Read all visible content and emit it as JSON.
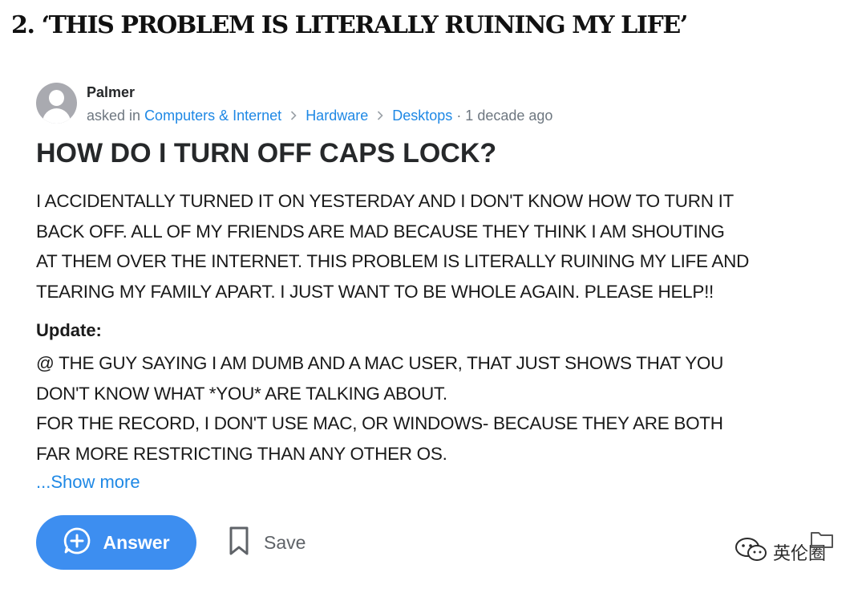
{
  "article": {
    "heading": "2. ‘THIS PROBLEM IS LITERALLY RUINING MY LIFE’"
  },
  "question": {
    "author": "Palmer",
    "asked_in_prefix": "asked in",
    "breadcrumb": [
      "Computers & Internet",
      "Hardware",
      "Desktops"
    ],
    "time_ago": "· 1 decade ago",
    "title": "HOW DO I TURN OFF CAPS LOCK?",
    "body_lines": [
      "I ACCIDENTALLY TURNED IT ON YESTERDAY AND I DON'T KNOW HOW TO TURN IT",
      "BACK OFF. ALL OF MY FRIENDS ARE MAD BECAUSE THEY THINK I AM SHOUTING",
      "AT THEM OVER THE INTERNET. THIS PROBLEM IS LITERALLY RUINING MY LIFE AND",
      "TEARING MY FAMILY APART. I JUST WANT TO BE WHOLE AGAIN. PLEASE HELP!!"
    ],
    "update_label": "Update:",
    "update_lines": [
      "@ THE GUY SAYING I AM DUMB AND A MAC USER, THAT JUST SHOWS THAT YOU",
      "DON'T KNOW WHAT *YOU* ARE TALKING ABOUT.",
      "FOR THE RECORD, I DON'T USE MAC, OR WINDOWS- BECAUSE THEY ARE BOTH",
      "FAR MORE RESTRICTING THAN ANY OTHER OS."
    ],
    "show_more": "...Show more"
  },
  "actions": {
    "answer_label": "Answer",
    "save_label": "Save"
  },
  "watermark": {
    "text": "英伦圈"
  },
  "icons": {
    "avatar": "user-avatar-icon",
    "answer": "plus-circle-icon",
    "save": "bookmark-icon",
    "watermark": "wechat-icon",
    "folder": "folder-icon"
  },
  "colors": {
    "link": "#1e88e5",
    "answer_button": "#3d8ef0",
    "meta_text": "#6e7780",
    "avatar": "#a9aab0"
  }
}
